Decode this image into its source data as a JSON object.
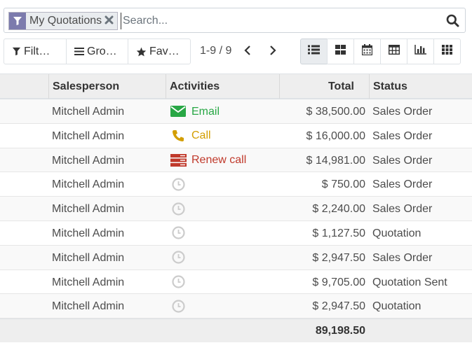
{
  "search": {
    "facet_label": "My Quotations",
    "placeholder": "Search...",
    "value": ""
  },
  "controls": {
    "filters_label": "Filt…",
    "groupby_label": "Gro…",
    "favorites_label": "Fav…",
    "pager_text": "1-9 / 9",
    "active_view": "list",
    "views": [
      "list-icon",
      "kanban-icon",
      "calendar-icon",
      "pivot-icon",
      "graph-icon",
      "grid-icon"
    ]
  },
  "table": {
    "headers": {
      "salesperson": "Salesperson",
      "activities": "Activities",
      "total": "Total",
      "status": "Status"
    },
    "rows": [
      {
        "salesperson": "Mitchell Admin",
        "activity": "Email",
        "activity_icon": "envelope-icon",
        "activity_color": "#28a745",
        "total": "$ 38,500.00",
        "status": "Sales Order"
      },
      {
        "salesperson": "Mitchell Admin",
        "activity": "Call",
        "activity_icon": "phone-icon",
        "activity_color": "#d39e00",
        "total": "$ 16,000.00",
        "status": "Sales Order"
      },
      {
        "salesperson": "Mitchell Admin",
        "activity": "Renew call",
        "activity_icon": "server-icon",
        "activity_color": "#c0392b",
        "total": "$ 14,981.00",
        "status": "Sales Order"
      },
      {
        "salesperson": "Mitchell Admin",
        "activity": "",
        "activity_icon": "clock-icon",
        "activity_color": "#cccccc",
        "total": "$ 750.00",
        "status": "Sales Order"
      },
      {
        "salesperson": "Mitchell Admin",
        "activity": "",
        "activity_icon": "clock-icon",
        "activity_color": "#cccccc",
        "total": "$ 2,240.00",
        "status": "Sales Order"
      },
      {
        "salesperson": "Mitchell Admin",
        "activity": "",
        "activity_icon": "clock-icon",
        "activity_color": "#cccccc",
        "total": "$ 1,127.50",
        "status": "Quotation"
      },
      {
        "salesperson": "Mitchell Admin",
        "activity": "",
        "activity_icon": "clock-icon",
        "activity_color": "#cccccc",
        "total": "$ 2,947.50",
        "status": "Sales Order"
      },
      {
        "salesperson": "Mitchell Admin",
        "activity": "",
        "activity_icon": "clock-icon",
        "activity_color": "#cccccc",
        "total": "$ 9,705.00",
        "status": "Quotation Sent"
      },
      {
        "salesperson": "Mitchell Admin",
        "activity": "",
        "activity_icon": "clock-icon",
        "activity_color": "#cccccc",
        "total": "$ 2,947.50",
        "status": "Quotation"
      }
    ],
    "footer_total": "89,198.50"
  }
}
